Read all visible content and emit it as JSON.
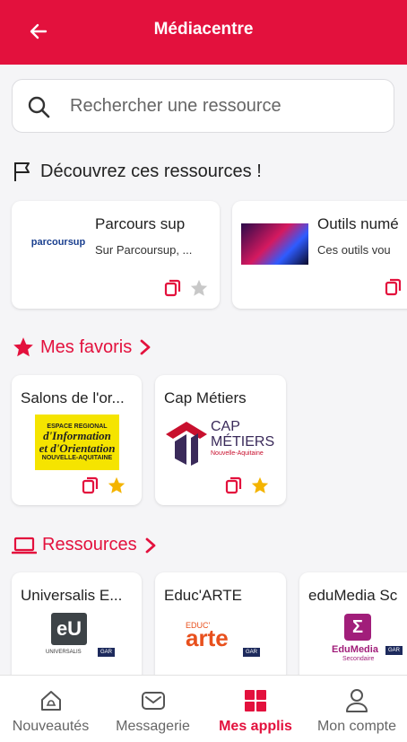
{
  "header": {
    "title": "Médiacentre"
  },
  "search": {
    "placeholder": "Rechercher une ressource"
  },
  "discover": {
    "title": "Découvrez ces ressources !",
    "cards": [
      {
        "name": "Parcours sup",
        "description": "Sur Parcoursup, ...",
        "logo_text": "parcoursup"
      },
      {
        "name": "Outils numé",
        "description": "Ces outils vou"
      }
    ]
  },
  "favorites": {
    "title": "Mes favoris",
    "cards": [
      {
        "name": "Salons de l'or...",
        "logo_lines": [
          "ESPACE REGIONAL",
          "d'Information",
          "et d'Orientation",
          "NOUVELLE-AQUITAINE"
        ]
      },
      {
        "name": "Cap Métiers",
        "logo_lines": [
          "CAP",
          "MÉTIERS",
          "Nouvelle-Aquitaine"
        ]
      }
    ]
  },
  "resources": {
    "title": "Ressources",
    "cards": [
      {
        "name": "Universalis E...",
        "logo_text": "eU",
        "logo_sub": "UNIVERSALIS",
        "badge": "GAR"
      },
      {
        "name": "Educ'ARTE",
        "logo_text": "arte",
        "logo_top": "EDUC'",
        "badge": "GAR"
      },
      {
        "name": "eduMedia Sc",
        "logo_text": "EduMedia",
        "logo_sub": "Secondaire",
        "badge": "GAR"
      }
    ]
  },
  "bottom_nav": [
    {
      "label": "Nouveautés",
      "icon": "home-bell-icon",
      "active": false
    },
    {
      "label": "Messagerie",
      "icon": "mail-icon",
      "active": false
    },
    {
      "label": "Mes applis",
      "icon": "apps-grid-icon",
      "active": true
    },
    {
      "label": "Mon compte",
      "icon": "user-icon",
      "active": false
    }
  ],
  "colors": {
    "primary": "#e3113d",
    "favorite_star": "#f4b400",
    "inactive_star": "#c8c8c8"
  }
}
